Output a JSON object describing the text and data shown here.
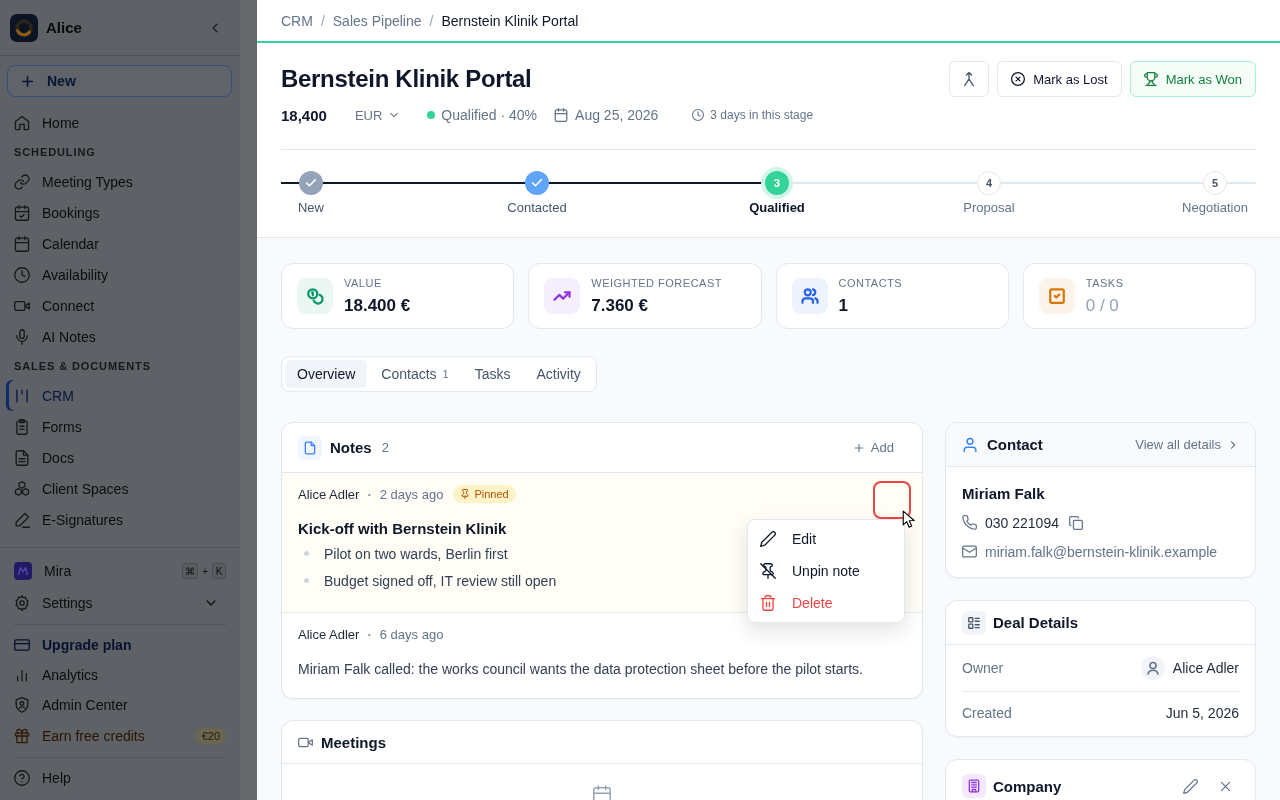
{
  "sidebar": {
    "workspace": "Alice",
    "new_button": "New",
    "nav": [
      {
        "kind": "link",
        "label": "Home",
        "selected": false
      },
      {
        "kind": "section",
        "label": "SCHEDULING"
      },
      {
        "kind": "link",
        "label": "Meeting Types",
        "selected": false
      },
      {
        "kind": "link",
        "label": "Bookings",
        "selected": false
      },
      {
        "kind": "link",
        "label": "Calendar",
        "selected": false
      },
      {
        "kind": "link",
        "label": "Availability",
        "selected": false
      },
      {
        "kind": "link",
        "label": "Connect",
        "selected": false
      },
      {
        "kind": "link",
        "label": "AI Notes",
        "selected": false
      },
      {
        "kind": "section",
        "label": "SALES & DOCUMENTS"
      },
      {
        "kind": "link",
        "label": "CRM",
        "selected": true
      },
      {
        "kind": "link",
        "label": "Forms",
        "selected": false
      },
      {
        "kind": "link",
        "label": "Docs",
        "selected": false
      },
      {
        "kind": "link",
        "label": "Client Spaces",
        "selected": false
      },
      {
        "kind": "link",
        "label": "E-Signatures",
        "selected": false
      }
    ],
    "assistant": {
      "label": "Mira",
      "keys": [
        "⌘",
        "K"
      ],
      "joiner": "+"
    },
    "settings": {
      "label": "Settings",
      "expanded": false
    },
    "footer": [
      {
        "kind": "upgrade",
        "label": "Upgrade plan",
        "selected": false
      },
      {
        "kind": "link",
        "label": "Analytics",
        "selected": false
      },
      {
        "kind": "link",
        "label": "Admin Center",
        "selected": false
      },
      {
        "kind": "promo",
        "label": "Earn free credits",
        "badge": "€20",
        "selected": false
      }
    ],
    "help": {
      "label": "Help"
    }
  },
  "breadcrumb": [
    {
      "kind": "link",
      "label": "CRM"
    },
    {
      "kind": "separator",
      "label": "/"
    },
    {
      "kind": "link",
      "label": "Sales Pipeline"
    },
    {
      "kind": "separator",
      "label": "/"
    },
    {
      "kind": "current",
      "label": "Bernstein Klinik Portal"
    }
  ],
  "deal": {
    "title": "Bernstein Klinik Portal",
    "amount": "18,400",
    "currency": "EUR",
    "stage": {
      "label": "Qualified · 40%",
      "color": "#34d399"
    },
    "close_date": "Aug 25, 2026",
    "stage_age": "3 days in this stage",
    "actions": [
      {
        "kind": "icon"
      },
      {
        "kind": "lost",
        "label": "Mark as Lost"
      },
      {
        "kind": "won",
        "label": "Mark as Won"
      }
    ]
  },
  "stepper": {
    "steps": [
      {
        "label": "New",
        "done": true,
        "current": false,
        "color": "#94a3b8"
      },
      {
        "label": "Contacted",
        "done": true,
        "current": false,
        "color": "#60a5fa"
      },
      {
        "label": "Qualified",
        "done": false,
        "current": true,
        "number": "3",
        "color": "#34d399"
      },
      {
        "label": "Proposal",
        "done": false,
        "current": false,
        "number": "4"
      },
      {
        "label": "Negotiation",
        "done": false,
        "current": false,
        "number": "5"
      }
    ]
  },
  "stats": [
    {
      "label": "VALUE",
      "value": "18.400 €",
      "muted": false
    },
    {
      "label": "WEIGHTED FORECAST",
      "value": "7.360 €",
      "muted": false
    },
    {
      "label": "CONTACTS",
      "value": "1",
      "muted": false
    },
    {
      "label": "TASKS",
      "value": "0 / 0",
      "muted": true
    }
  ],
  "tabs": [
    {
      "label": "Overview",
      "selected": true
    },
    {
      "label": "Contacts",
      "count": "1",
      "selected": false
    },
    {
      "label": "Tasks",
      "selected": false
    },
    {
      "label": "Activity",
      "selected": false
    }
  ],
  "notes": {
    "title": "Notes",
    "count": "2",
    "add_label": "Add",
    "items": [
      {
        "author": "Alice Adler",
        "separator": "·",
        "time": "2 days ago",
        "pinned": true,
        "badge": "Pinned",
        "menu_open": true,
        "title": "Kick-off with Bernstein Klinik",
        "bullets": [
          "Pilot on two wards, Berlin first",
          "Budget signed off, IT review still open"
        ],
        "menu": [
          {
            "kind": "edit",
            "label": "Edit"
          },
          {
            "kind": "unpin",
            "label": "Unpin note"
          },
          {
            "kind": "delete",
            "label": "Delete"
          }
        ]
      },
      {
        "author": "Alice Adler",
        "separator": "·",
        "time": "6 days ago",
        "pinned": false,
        "menu_open": false,
        "text": "Miriam Falk called: the works council wants the data protection sheet before the pilot starts."
      }
    ]
  },
  "meetings": {
    "title": "Meetings"
  },
  "contact": {
    "title": "Contact",
    "link": "View all details",
    "name": "Miriam Falk",
    "phone": "030 221094",
    "email": "miriam.falk@bernstein-klinik.example"
  },
  "deal_details": {
    "title": "Deal Details",
    "rows": [
      {
        "kind": "person",
        "label": "Owner",
        "value": "Alice Adler"
      },
      {
        "kind": "date",
        "label": "Created",
        "value": "Jun 5, 2026"
      }
    ]
  },
  "company": {
    "title": "Company"
  }
}
